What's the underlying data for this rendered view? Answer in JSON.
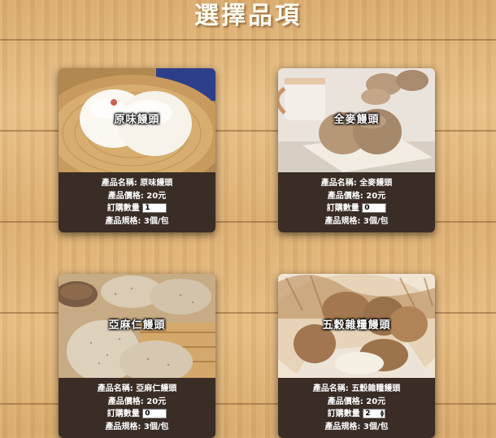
{
  "page": {
    "title": "選擇品項"
  },
  "labels": {
    "name": "產品名稱: ",
    "price": "產品價格: ",
    "qty": "訂購數量",
    "spec": "產品規格: "
  },
  "products": [
    {
      "photo_label": "原味饅頭",
      "name": "原味饅頭",
      "price": "20元",
      "qty": "1",
      "spec": "3個/包"
    },
    {
      "photo_label": "全麥饅頭",
      "name": "全麥饅頭",
      "price": "20元",
      "qty": "0",
      "spec": "3個/包"
    },
    {
      "photo_label": "亞麻仁饅頭",
      "name": "亞麻仁饅頭",
      "price": "20元",
      "qty": "0",
      "spec": "3個/包"
    },
    {
      "photo_label": "五穀雜糧饅頭",
      "name": "五穀雜糧饅頭",
      "price": "20元",
      "qty": "2",
      "spec": "3個/包"
    }
  ],
  "colors": {
    "card_info_bg": "#3a2d26",
    "title_text": "#fffaf0"
  }
}
